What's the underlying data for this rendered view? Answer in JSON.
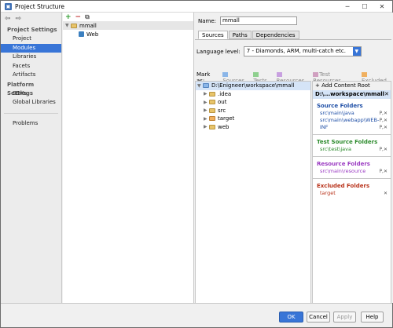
{
  "window": {
    "title": "Project Structure"
  },
  "nav": {
    "project_settings_header": "Project Settings",
    "project_settings": [
      "Project",
      "Modules",
      "Libraries",
      "Facets",
      "Artifacts"
    ],
    "platform_settings_header": "Platform Settings",
    "platform_settings": [
      "SDKs",
      "Global Libraries"
    ],
    "problems": "Problems"
  },
  "modules_tree": {
    "root": "mmall",
    "child": "Web"
  },
  "module": {
    "name_label": "Name:",
    "name_value": "mmall",
    "tabs": [
      "Sources",
      "Paths",
      "Dependencies"
    ],
    "language_level_label": "Language level:",
    "language_level_value": "7 - Diamonds, ARM, multi-catch etc.",
    "mark_as_label": "Mark as:",
    "mark_as_options": [
      "Sources",
      "Tests",
      "Resources",
      "Test Resources",
      "Excluded"
    ],
    "tree_root": "D:\\Enigneer\\workspace\\mmall",
    "tree_children": [
      ".idea",
      "out",
      "src",
      "target",
      "web"
    ]
  },
  "content_root": {
    "add_label": "+ Add Content Root",
    "root_label": "D:\\...workspace\\mmall",
    "source_folders_header": "Source Folders",
    "source_folders": [
      "src\\main\\java",
      "src\\main\\webapp\\WEB-INF",
      "."
    ],
    "test_source_folders_header": "Test Source Folders",
    "test_source_folders": [
      "src\\test\\java"
    ],
    "resource_folders_header": "Resource Folders",
    "resource_folders": [
      "src\\main\\resource"
    ],
    "excluded_folders_header": "Excluded Folders",
    "excluded_folders": [
      "target"
    ]
  },
  "buttons": {
    "ok": "OK",
    "cancel": "Cancel",
    "apply": "Apply",
    "help": "Help"
  },
  "colors": {
    "selection": "#3875d7",
    "source": "#1f4fa6",
    "test": "#2a8a2a",
    "resource": "#9a3ac2",
    "excluded": "#b8321a"
  }
}
